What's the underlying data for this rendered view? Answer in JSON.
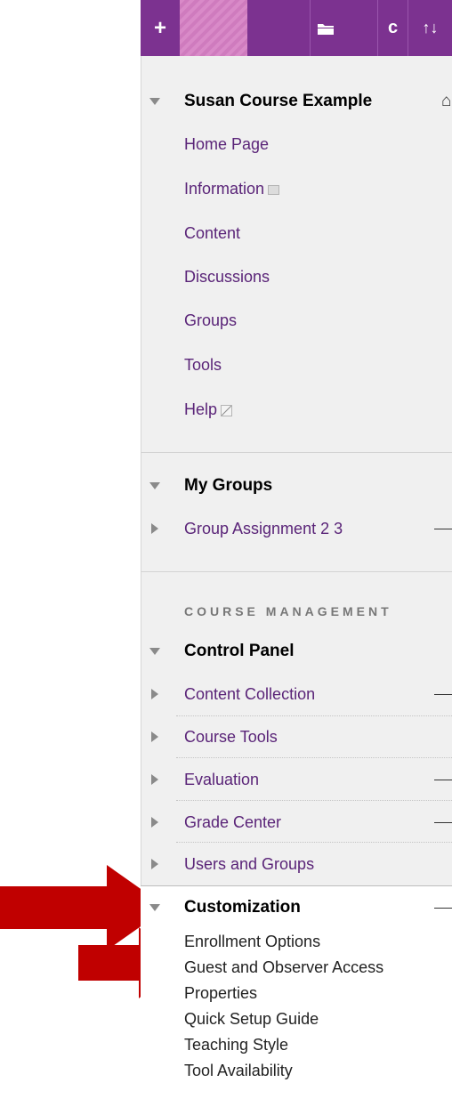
{
  "toolbar": {
    "plus_icon": "+",
    "folder_icon": "folder-icon",
    "refresh_icon": "refresh-icon",
    "sort_icon": "sort-icon",
    "plus_glyph": "+",
    "refresh_glyph": "c",
    "sort_glyph": "↑↓"
  },
  "course": {
    "title": "Susan Course Example",
    "items": [
      {
        "label": "Home Page"
      },
      {
        "label": "Information"
      },
      {
        "label": "Content"
      },
      {
        "label": "Discussions"
      },
      {
        "label": "Groups"
      },
      {
        "label": "Tools"
      },
      {
        "label": "Help"
      }
    ]
  },
  "my_groups": {
    "title": "My Groups",
    "items": [
      {
        "label": "Group Assignment 2 3"
      }
    ]
  },
  "course_management": {
    "label": "COURSE MANAGEMENT",
    "control_panel": "Control Panel",
    "items": [
      {
        "label": "Content Collection"
      },
      {
        "label": "Course Tools"
      },
      {
        "label": "Evaluation"
      },
      {
        "label": "Grade Center"
      },
      {
        "label": "Users and Groups"
      }
    ],
    "customization": {
      "title": "Customization",
      "items": [
        {
          "label": "Enrollment Options"
        },
        {
          "label": "Guest and Observer Access"
        },
        {
          "label": "Properties"
        },
        {
          "label": "Quick Setup Guide"
        },
        {
          "label": "Teaching Style"
        },
        {
          "label": "Tool Availability"
        }
      ]
    }
  },
  "colors": {
    "toolbar": "#7c3290",
    "link": "#5a2478",
    "arrow": "#c00000",
    "panel_bg": "#f0f0f0"
  }
}
